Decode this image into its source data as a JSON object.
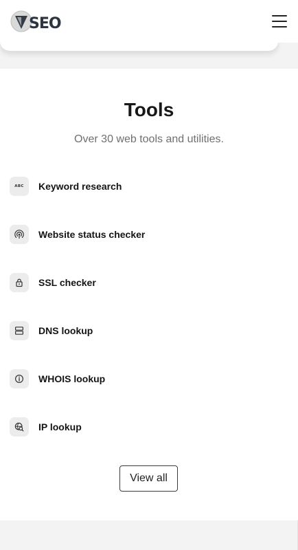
{
  "header": {
    "logo_text": "SEO",
    "menu_icon": "hamburger-menu-icon"
  },
  "tools": {
    "title": "Tools",
    "subtitle": "Over 30 web tools and utilities.",
    "items": [
      {
        "label": "Keyword research",
        "icon": "abc-icon",
        "icon_text": "ABC"
      },
      {
        "label": "Website status checker",
        "icon": "signal-icon"
      },
      {
        "label": "SSL checker",
        "icon": "lock-icon"
      },
      {
        "label": "DNS lookup",
        "icon": "server-icon"
      },
      {
        "label": "WHOIS lookup",
        "icon": "info-icon"
      },
      {
        "label": "IP lookup",
        "icon": "globe-search-icon"
      }
    ],
    "view_all_label": "View all"
  },
  "colors": {
    "page_background": "#f3f3f3",
    "card_background": "#ffffff",
    "icon_background": "#ececec",
    "subtitle_text": "#6f6f6f"
  }
}
